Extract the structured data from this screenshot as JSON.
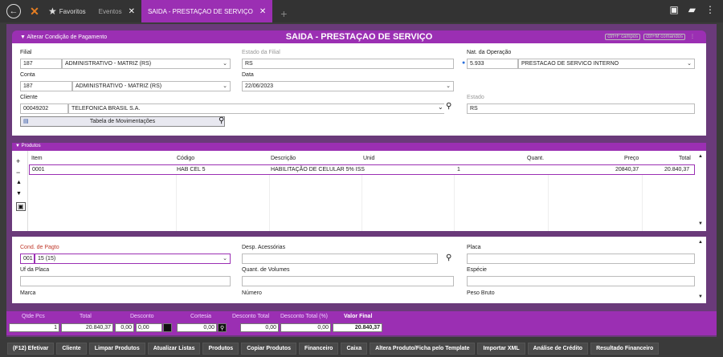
{
  "topbar": {
    "favoritos": "Favoritos",
    "eventos": "Eventos",
    "tab_title": "SAIDA - PRESTAÇAO DE SERVIÇO"
  },
  "header": {
    "section": "▼ Alterar Condição de Pagamento",
    "title": "SAIDA - PRESTAÇAO DE SERVIÇO",
    "btn1": "ctrl+F campos",
    "btn2": "ctrl+M comandos"
  },
  "form": {
    "filial_label": "Filial",
    "filial_code": "187",
    "filial_name": "ADMINISTRATIVO - MATRIZ (RS)",
    "estado_filial_label": "Estado da Filial",
    "estado_filial": "RS",
    "nat_label": "Nat. da Operação",
    "nat_code": "5.933",
    "nat_name": "PRESTACAO DE SERVICO INTERNO",
    "conta_label": "Conta",
    "conta_code": "187",
    "conta_name": "ADMINISTRATIVO - MATRIZ (RS)",
    "data_label": "Data",
    "data": "22/06/2023",
    "cliente_label": "Cliente",
    "cliente_code": "00049202",
    "cliente_name": "TELEFONICA BRASIL S.A.",
    "estado_label": "Estado",
    "estado": "RS",
    "tabela_btn": "Tabela de Movimentações"
  },
  "produtos": {
    "bar": "▼ Produtos",
    "headers": {
      "item": "Item",
      "codigo": "Código",
      "descricao": "Descrição",
      "unid": "Unid",
      "quant": "Quant.",
      "preco": "Preço",
      "total": "Total"
    },
    "row": {
      "item": "0001",
      "codigo": "HAB CEL 5",
      "descricao": "HABILITAÇÃO DE CELULAR 5% ISS",
      "unid": "1",
      "preco": "20840,37",
      "total": "20.840,37"
    }
  },
  "cond": {
    "cond_label": "Cond. de Pagto",
    "cond_code": "001",
    "cond_name": "15 (15)",
    "desp_label": "Desp. Acessórias",
    "placa_label": "Placa",
    "uf_label": "Uf da Placa",
    "quant_vol_label": "Quant. de Volumes",
    "especie_label": "Espécie",
    "marca_label": "Marca",
    "numero_label": "Número",
    "peso_label": "Peso Bruto"
  },
  "totals": {
    "qtde_label": "Qtde Pcs",
    "qtde": "1",
    "total_label": "Total",
    "total": "20.840,37",
    "desconto_label": "Desconto",
    "desc1": "0,00",
    "desc2": "0,00",
    "cortesia_label": "Cortesia",
    "cortesia": "0,00",
    "desc_total_label": "Desconto Total",
    "desc_total": "0,00",
    "desc_pct_label": "Desconto Total (%)",
    "desc_pct": "0,00",
    "valor_final_label": "Valor Final",
    "valor_final": "20.840,37"
  },
  "toolbar": [
    "(F12) Efetivar",
    "Cliente",
    "Limpar Produtos",
    "Atualizar Listas",
    "Produtos",
    "Copiar Produtos",
    "Financeiro",
    "Caixa",
    "Altera Produto/Ficha pelo Template",
    "Importar XML",
    "Análise de Crédito",
    "Resultado Financeiro"
  ]
}
